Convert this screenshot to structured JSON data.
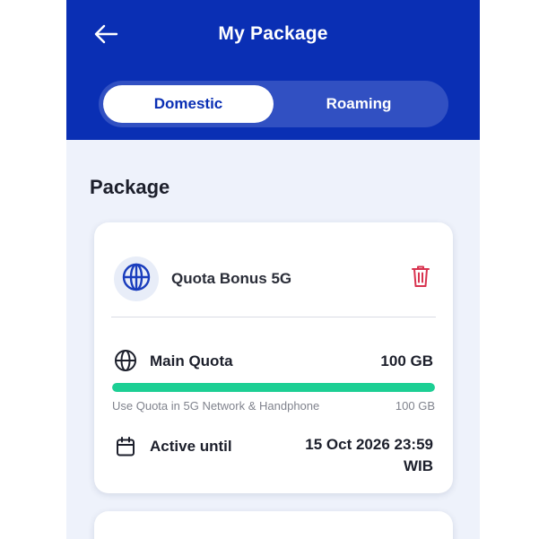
{
  "header": {
    "title": "My Package",
    "back_icon": "arrow-left-icon",
    "bg_color": "#0a2fb4"
  },
  "tabs": [
    {
      "label": "Domestic",
      "active": true
    },
    {
      "label": "Roaming",
      "active": false
    }
  ],
  "section_title": "Package",
  "package_card": {
    "icon": "globe-icon",
    "name": "Quota Bonus 5G",
    "delete_icon": "trash-icon",
    "main_quota": {
      "icon": "globe-icon",
      "label": "Main Quota",
      "value": "100 GB",
      "remaining_fraction": 1.0,
      "bar_color": "#1ccf94"
    },
    "usage_note": "Use Quota in 5G Network & Handphone",
    "usage_value": "100 GB",
    "active_until": {
      "icon": "calendar-icon",
      "label": "Active until",
      "date": "15 Oct 2026 23:59",
      "timezone": "WIB"
    }
  }
}
